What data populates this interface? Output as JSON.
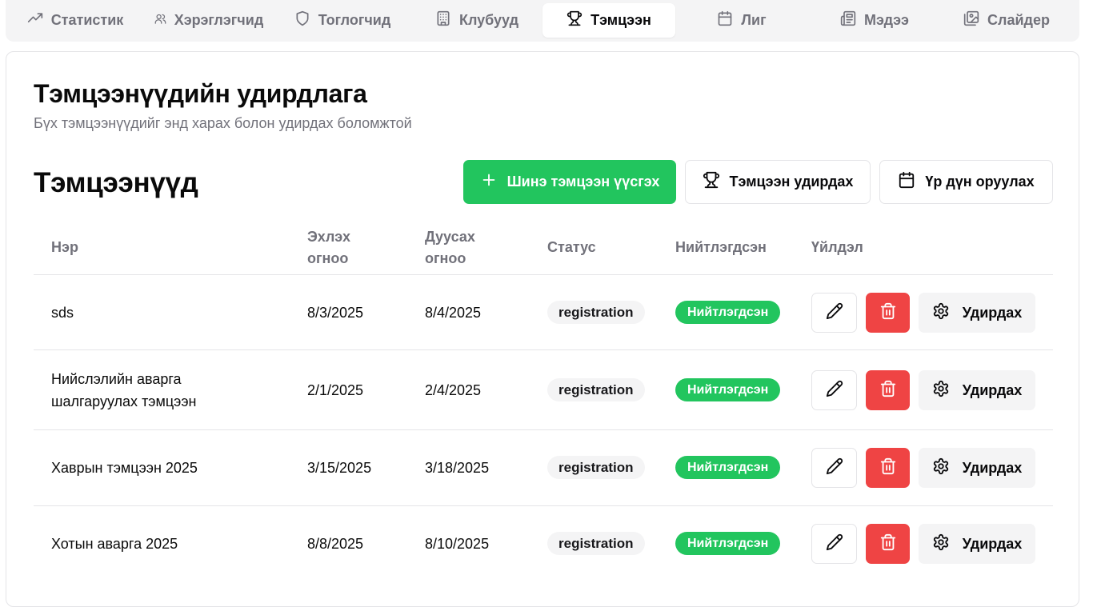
{
  "tabs": [
    {
      "label": "Статистик",
      "icon": "trending-up-icon"
    },
    {
      "label": "Хэрэглэгчид",
      "icon": "users-icon"
    },
    {
      "label": "Тоглогчид",
      "icon": "shield-icon"
    },
    {
      "label": "Клубууд",
      "icon": "building-icon"
    },
    {
      "label": "Тэмцээн",
      "icon": "trophy-icon",
      "active": true
    },
    {
      "label": "Лиг",
      "icon": "calendar-icon"
    },
    {
      "label": "Мэдээ",
      "icon": "newspaper-icon"
    },
    {
      "label": "Слайдер",
      "icon": "images-icon"
    }
  ],
  "header": {
    "title": "Тэмцээнүүдийн удирдлага",
    "subtitle": "Бүх тэмцээнүүдийг энд харах болон удирдах боломжтой"
  },
  "section": {
    "title": "Тэмцээнүүд",
    "buttons": {
      "create": "Шинэ тэмцээн үүсгэх",
      "manage": "Тэмцээн удирдах",
      "results": "Үр дүн оруулах"
    }
  },
  "table": {
    "columns": {
      "name": "Нэр",
      "start": "Эхлэх огноо",
      "end": "Дуусах огноо",
      "status": "Статус",
      "published": "Нийтлэгдсэн",
      "actions": "Үйлдэл"
    },
    "rows": [
      {
        "name": "sds",
        "start": "8/3/2025",
        "end": "8/4/2025",
        "status": "registration",
        "published": "Нийтлэгдсэн",
        "manage": "Удирдах"
      },
      {
        "name": "Нийслэлийн аварга шалгаруулах тэмцээн",
        "start": "2/1/2025",
        "end": "2/4/2025",
        "status": "registration",
        "published": "Нийтлэгдсэн",
        "manage": "Удирдах"
      },
      {
        "name": "Хаврын тэмцээн 2025",
        "start": "3/15/2025",
        "end": "3/18/2025",
        "status": "registration",
        "published": "Нийтлэгдсэн",
        "manage": "Удирдах"
      },
      {
        "name": "Хотын аварга 2025",
        "start": "8/8/2025",
        "end": "8/10/2025",
        "status": "registration",
        "published": "Нийтлэгдсэн",
        "manage": "Удирдах"
      }
    ]
  },
  "colors": {
    "accent_green": "#22c55e",
    "danger_red": "#ef4444",
    "muted_text": "#71717a",
    "border": "#e4e4e7"
  }
}
